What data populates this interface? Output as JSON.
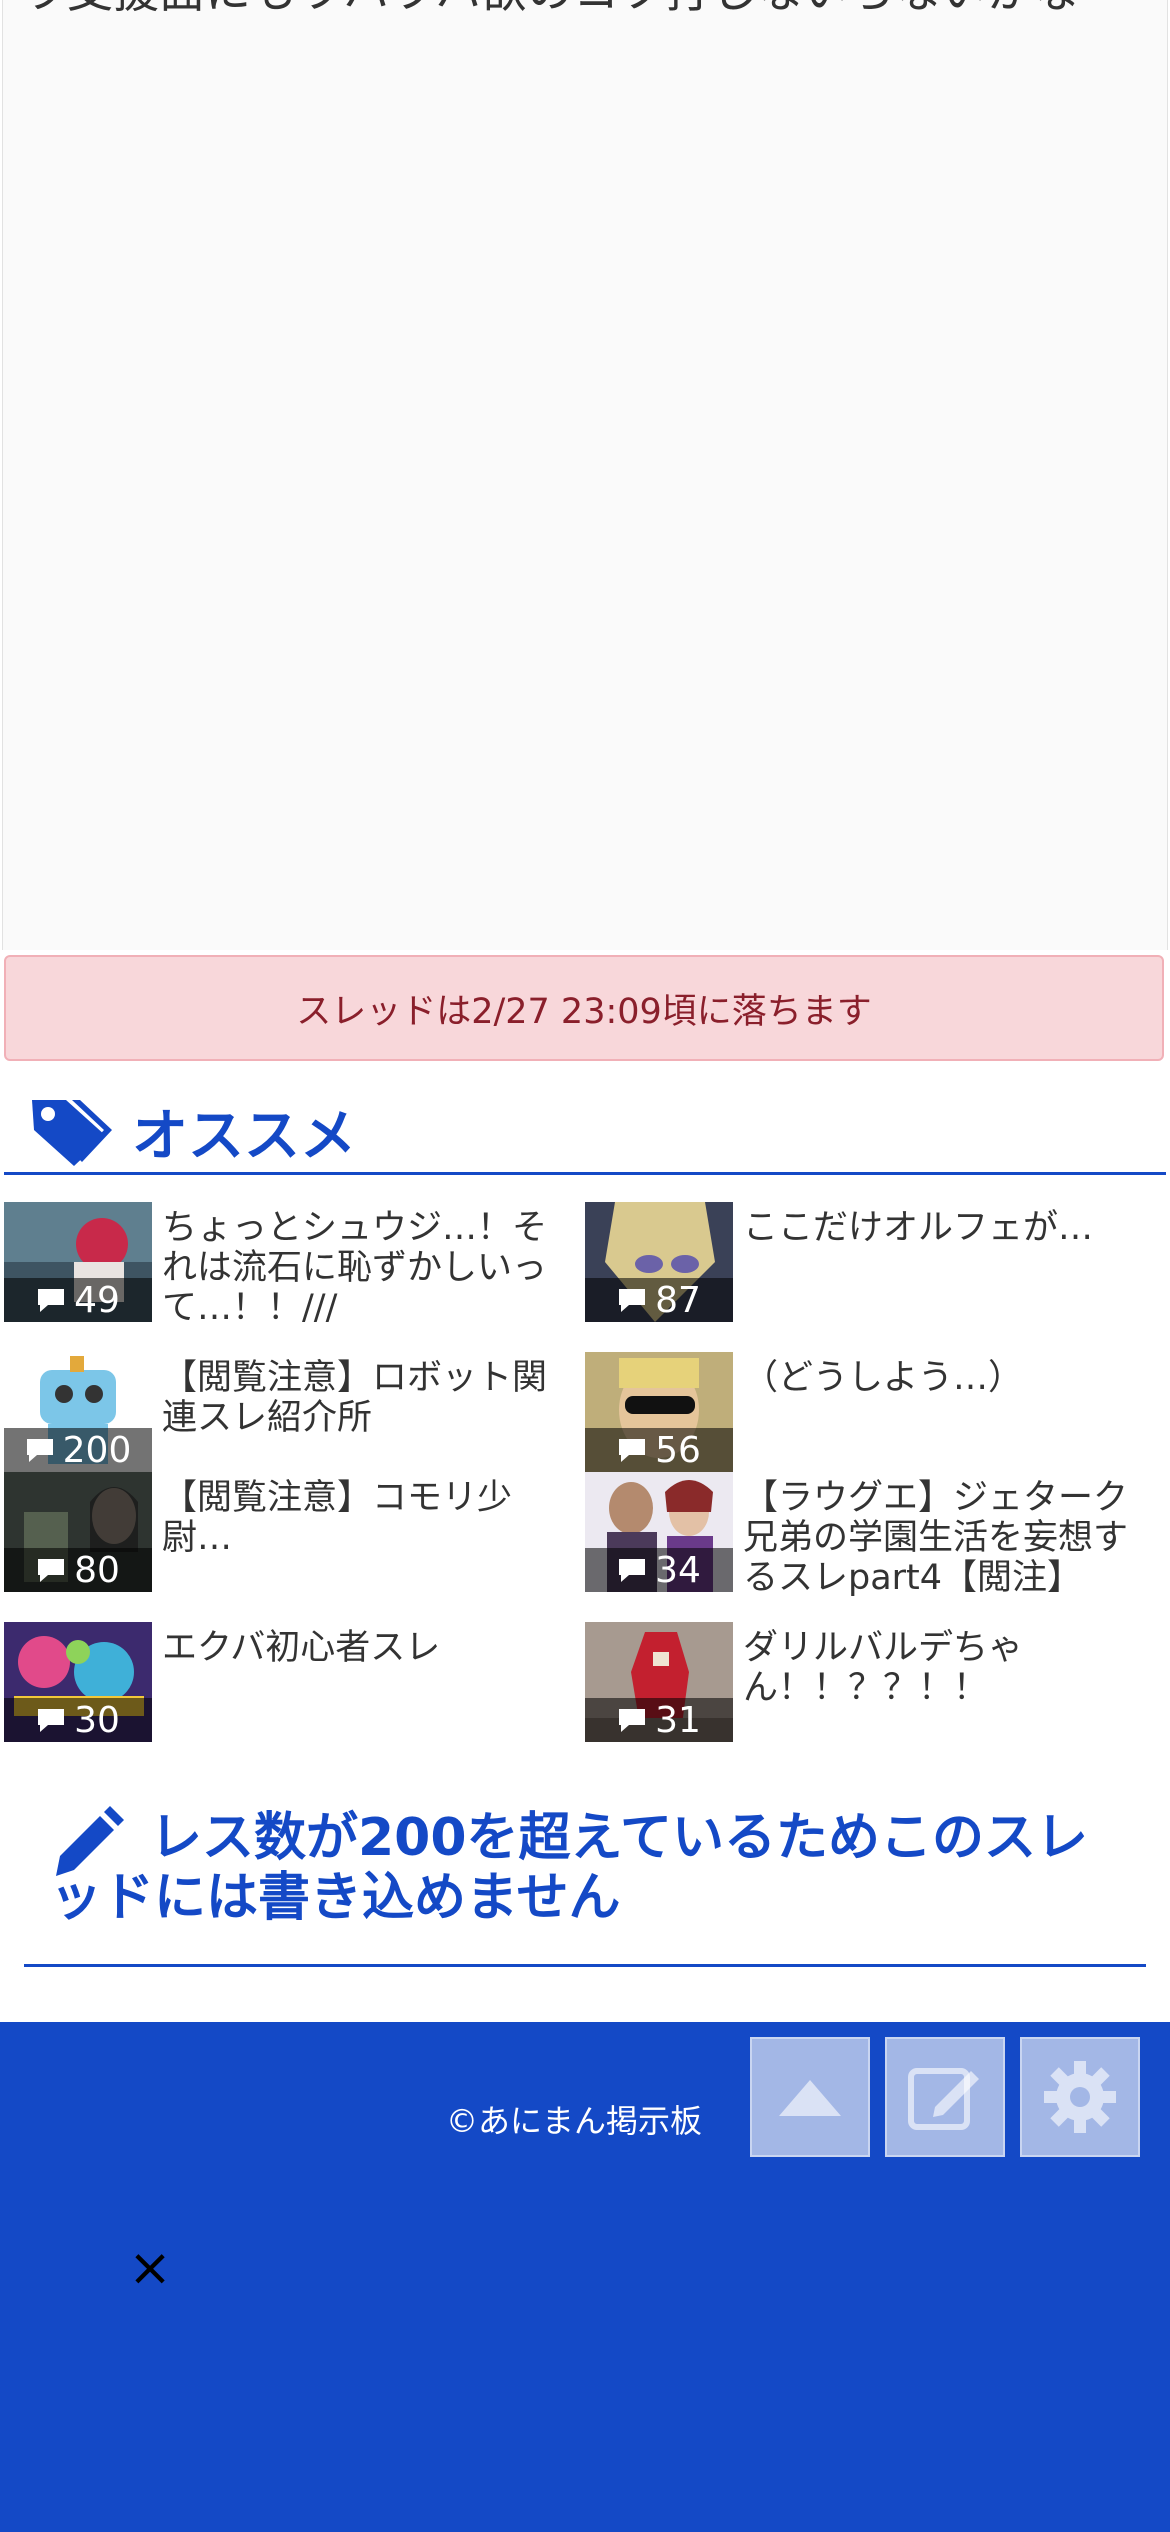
{
  "post": {
    "text": "ラ支援面にもウハウハ欲のコツ打しないらないかな"
  },
  "notice": {
    "text": "スレッドは2/27 23:09頃に落ちます"
  },
  "recommended": {
    "title": "オススメ",
    "items": [
      {
        "count": "49",
        "title": "ちょっとシュウジ…！それは流石に恥ずかしいって…！！///"
      },
      {
        "count": "87",
        "title": "ここだけオルフェが…"
      },
      {
        "count": "200",
        "title": "【閲覧注意】ロボット関連スレ紹介所"
      },
      {
        "count": "56",
        "title": "（どうしよう…）"
      },
      {
        "count": "80",
        "title": "【閲覧注意】コモリ少尉…"
      },
      {
        "count": "34",
        "title": "【ラウグエ】ジェターク兄弟の学園生活を妄想するスレpart4【閲注】"
      },
      {
        "count": "30",
        "title": "エクバ初心者スレ"
      },
      {
        "count": "31",
        "title": "ダリルバルデちゃん！！？？！！"
      }
    ]
  },
  "closed_message": "レス数が200を超えているためこのスレッドには書き込めません",
  "footer": {
    "copyright": "©あにまん掲示板",
    "close_glyph": "×"
  },
  "colors": {
    "brand_blue": "#1449c6",
    "notice_bg": "#f8d7da",
    "notice_text": "#8a1f2b"
  }
}
